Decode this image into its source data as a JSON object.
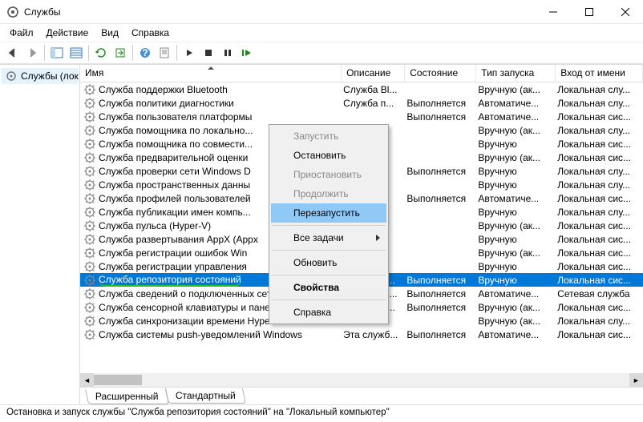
{
  "window": {
    "title": "Службы",
    "min_label": "Свернуть",
    "max_label": "Развернуть",
    "close_label": "Закрыть"
  },
  "menubar": {
    "file": "Файл",
    "action": "Действие",
    "view": "Вид",
    "help": "Справка"
  },
  "tree": {
    "root": "Службы (лок"
  },
  "columns": {
    "name": "Имя",
    "desc": "Описание",
    "state": "Состояние",
    "startup": "Тип запуска",
    "logon": "Вход от имени"
  },
  "services": [
    {
      "name": "Служба поддержки Bluetooth",
      "desc": "Служба Bl...",
      "state": "",
      "startup": "Вручную (ак...",
      "logon": "Локальная слу..."
    },
    {
      "name": "Служба политики диагностики",
      "desc": "Служба п...",
      "state": "Выполняется",
      "startup": "Автоматиче...",
      "logon": "Локальная слу..."
    },
    {
      "name": "Служба пользователя платформы",
      "desc": "",
      "state": "Выполняется",
      "startup": "Автоматиче...",
      "logon": "Локальная сис..."
    },
    {
      "name": "Служба помощника по локально...",
      "desc": "",
      "state": "",
      "startup": "Вручную (ак...",
      "logon": "Локальная слу..."
    },
    {
      "name": "Служба помощника по совмести...",
      "desc": "",
      "state": "",
      "startup": "Вручную",
      "logon": "Локальная сис..."
    },
    {
      "name": "Служба предварительной оценки",
      "desc": "",
      "state": "",
      "startup": "Вручную (ак...",
      "logon": "Локальная сис..."
    },
    {
      "name": "Служба проверки сети Windows D",
      "desc": "",
      "state": "Выполняется",
      "startup": "Вручную",
      "logon": "Локальная слу..."
    },
    {
      "name": "Служба пространственных данны",
      "desc": "",
      "state": "",
      "startup": "Вручную",
      "logon": "Локальная слу..."
    },
    {
      "name": "Служба профилей пользователей",
      "desc": "",
      "state": "Выполняется",
      "startup": "Автоматиче...",
      "logon": "Локальная сис..."
    },
    {
      "name": "Служба публикации имен компь...",
      "desc": "",
      "state": "",
      "startup": "Вручную",
      "logon": "Локальная слу..."
    },
    {
      "name": "Служба пульса (Hyper-V)",
      "desc": "",
      "state": "",
      "startup": "Вручную (ак...",
      "logon": "Локальная сис..."
    },
    {
      "name": "Служба развертывания AppX (Appx",
      "desc": "",
      "state": "",
      "startup": "Вручную",
      "logon": "Локальная сис..."
    },
    {
      "name": "Служба регистрации ошибок Win",
      "desc": "",
      "state": "",
      "startup": "Вручную (ак...",
      "logon": "Локальная сис..."
    },
    {
      "name": "Служба регистрации управления",
      "desc": "",
      "state": "",
      "startup": "Вручную",
      "logon": "Локальная сис..."
    },
    {
      "name": "Служба репозитория состояний",
      "desc": "Обеспечи...",
      "state": "Выполняется",
      "startup": "Вручную",
      "logon": "Локальная сис...",
      "selected": true,
      "highlight": true
    },
    {
      "name": "Служба сведений о подключенных сетях",
      "desc": "Собирает ...",
      "state": "Выполняется",
      "startup": "Автоматиче...",
      "logon": "Сетевая служба"
    },
    {
      "name": "Служба сенсорной клавиатуры и панели рукописн",
      "desc": "Обеспечи...",
      "state": "Выполняется",
      "startup": "Вручную (ак...",
      "logon": "Локальная сис..."
    },
    {
      "name": "Служба синхронизации времени Hyper-V",
      "desc": "",
      "state": "",
      "startup": "Вручную (ак...",
      "logon": "Локальная слу..."
    },
    {
      "name": "Служба системы push-уведомлений Windows",
      "desc": "Эта служб...",
      "state": "Выполняется",
      "startup": "Автоматиче...",
      "logon": "Локальная сис..."
    }
  ],
  "context_menu": {
    "start": "Запустить",
    "stop": "Остановить",
    "pause": "Приостановить",
    "resume": "Продолжить",
    "restart": "Перезапустить",
    "all_tasks": "Все задачи",
    "refresh": "Обновить",
    "properties": "Свойства",
    "help": "Справка"
  },
  "tabs": {
    "extended": "Расширенный",
    "standard": "Стандартный"
  },
  "status": "Остановка и запуск службы \"Служба репозитория состояний\" на \"Локальный компьютер\""
}
